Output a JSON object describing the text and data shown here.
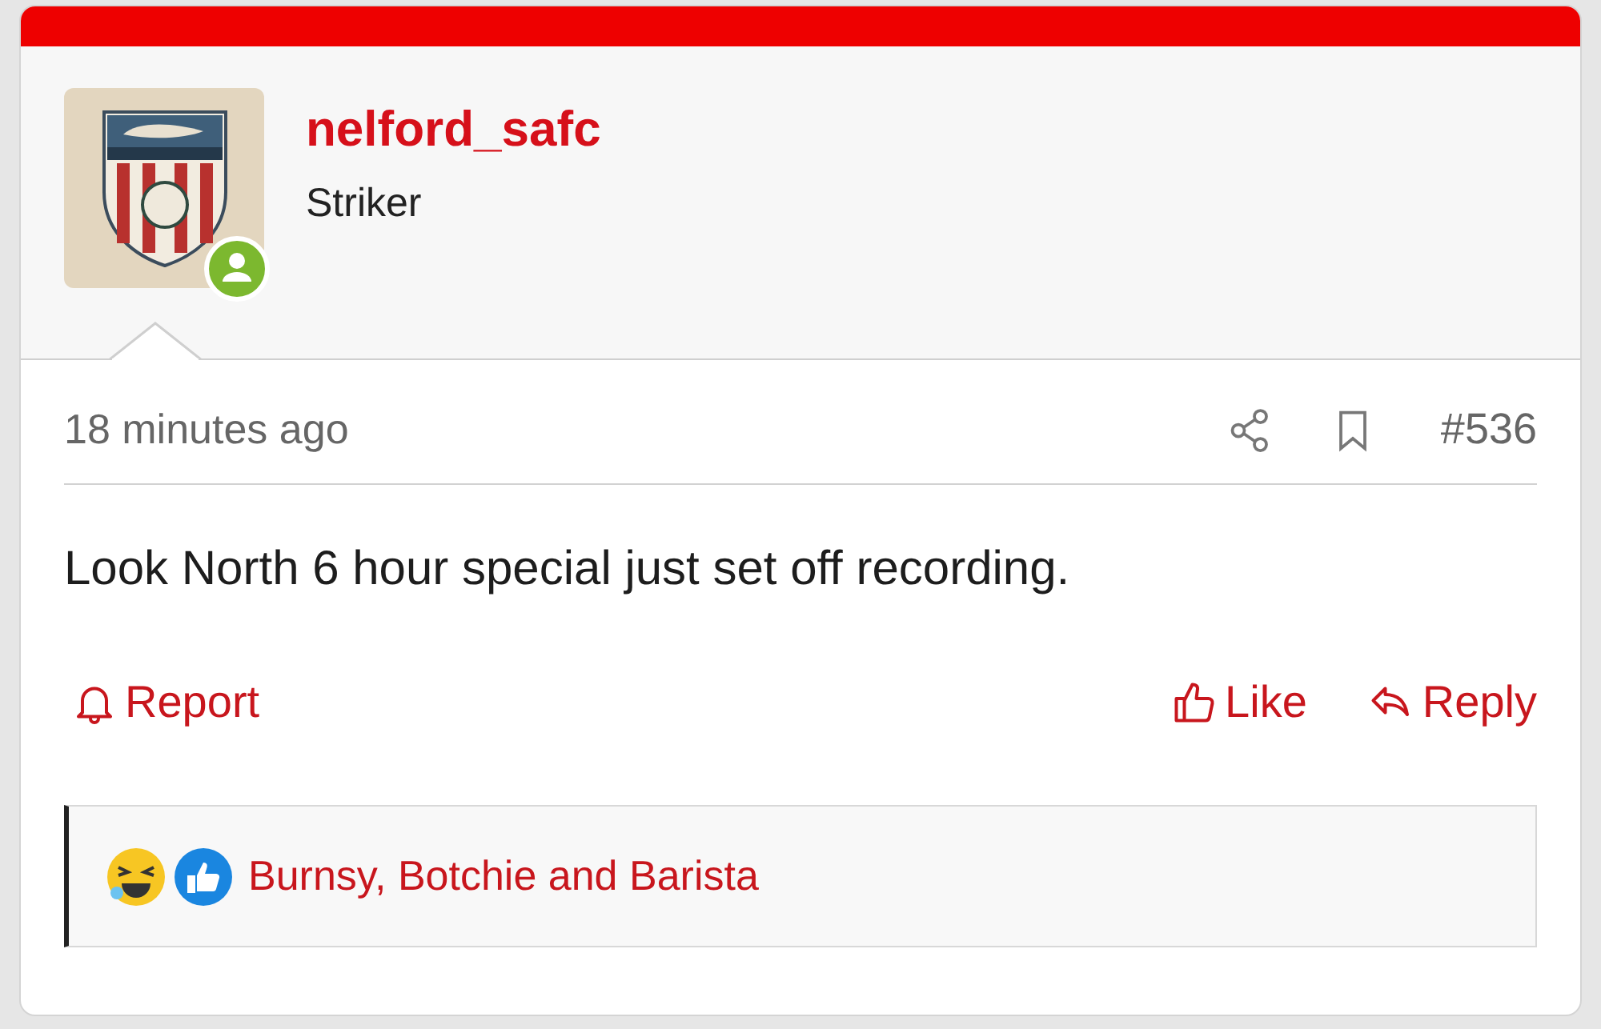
{
  "author": {
    "name": "nelford_safc",
    "title": "Striker",
    "online": true
  },
  "post": {
    "time": "18 minutes ago",
    "number": "#536",
    "message": "Look North 6 hour special just set off recording."
  },
  "actions": [
    {
      "kind": "report",
      "label": "Report"
    },
    {
      "kind": "like",
      "label": "Like"
    },
    {
      "kind": "reply",
      "label": "Reply"
    }
  ],
  "reactions": {
    "icons": [
      {
        "kind": "laugh"
      },
      {
        "kind": "like"
      }
    ],
    "names": "Burnsy, Botchie and Barista"
  }
}
